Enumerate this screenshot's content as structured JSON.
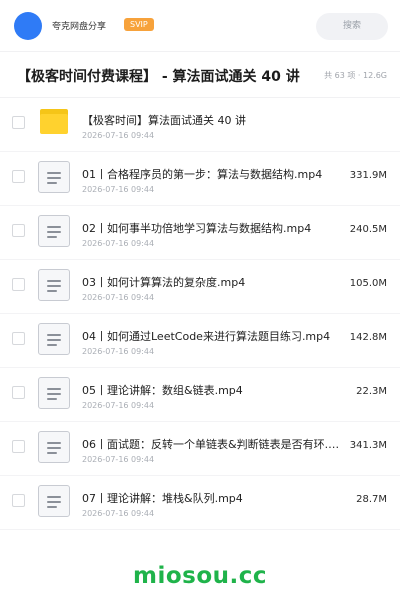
{
  "header": {
    "brand": "夸克网盘分享",
    "vip_badge": "SVIP",
    "search_label": "搜索"
  },
  "folder": {
    "title": "【极客时间付费课程】 - 算法面试通关 40 讲",
    "summary": "共 63 项 · 12.6G"
  },
  "files": [
    {
      "name": "【极客时间】算法面试通关 40 讲",
      "date": "2026-07-16 09:44",
      "size": "",
      "type": "folder"
    },
    {
      "name": "01丨合格程序员的第一步：算法与数据结构.mp4",
      "date": "2026-07-16 09:44",
      "size": "331.9M",
      "type": "video"
    },
    {
      "name": "02丨如何事半功倍地学习算法与数据结构.mp4",
      "date": "2026-07-16 09:44",
      "size": "240.5M",
      "type": "video"
    },
    {
      "name": "03丨如何计算算法的复杂度.mp4",
      "date": "2026-07-16 09:44",
      "size": "105.0M",
      "type": "video"
    },
    {
      "name": "04丨如何通过LeetCode来进行算法题目练习.mp4",
      "date": "2026-07-16 09:44",
      "size": "142.8M",
      "type": "video"
    },
    {
      "name": "05丨理论讲解：数组&链表.mp4",
      "date": "2026-07-16 09:44",
      "size": "22.3M",
      "type": "video"
    },
    {
      "name": "06丨面试题：反转一个单链表&判断链表是否有环.mp4",
      "date": "2026-07-16 09:44",
      "size": "341.3M",
      "type": "video"
    },
    {
      "name": "07丨理论讲解：堆栈&队列.mp4",
      "date": "2026-07-16 09:44",
      "size": "28.7M",
      "type": "video"
    }
  ],
  "watermark": "miosou.cc",
  "colors": {
    "accent": "#2f7bf6",
    "vip": "#f7a23b",
    "folder": "#ffd22e",
    "watermark": "#1fb34a"
  }
}
